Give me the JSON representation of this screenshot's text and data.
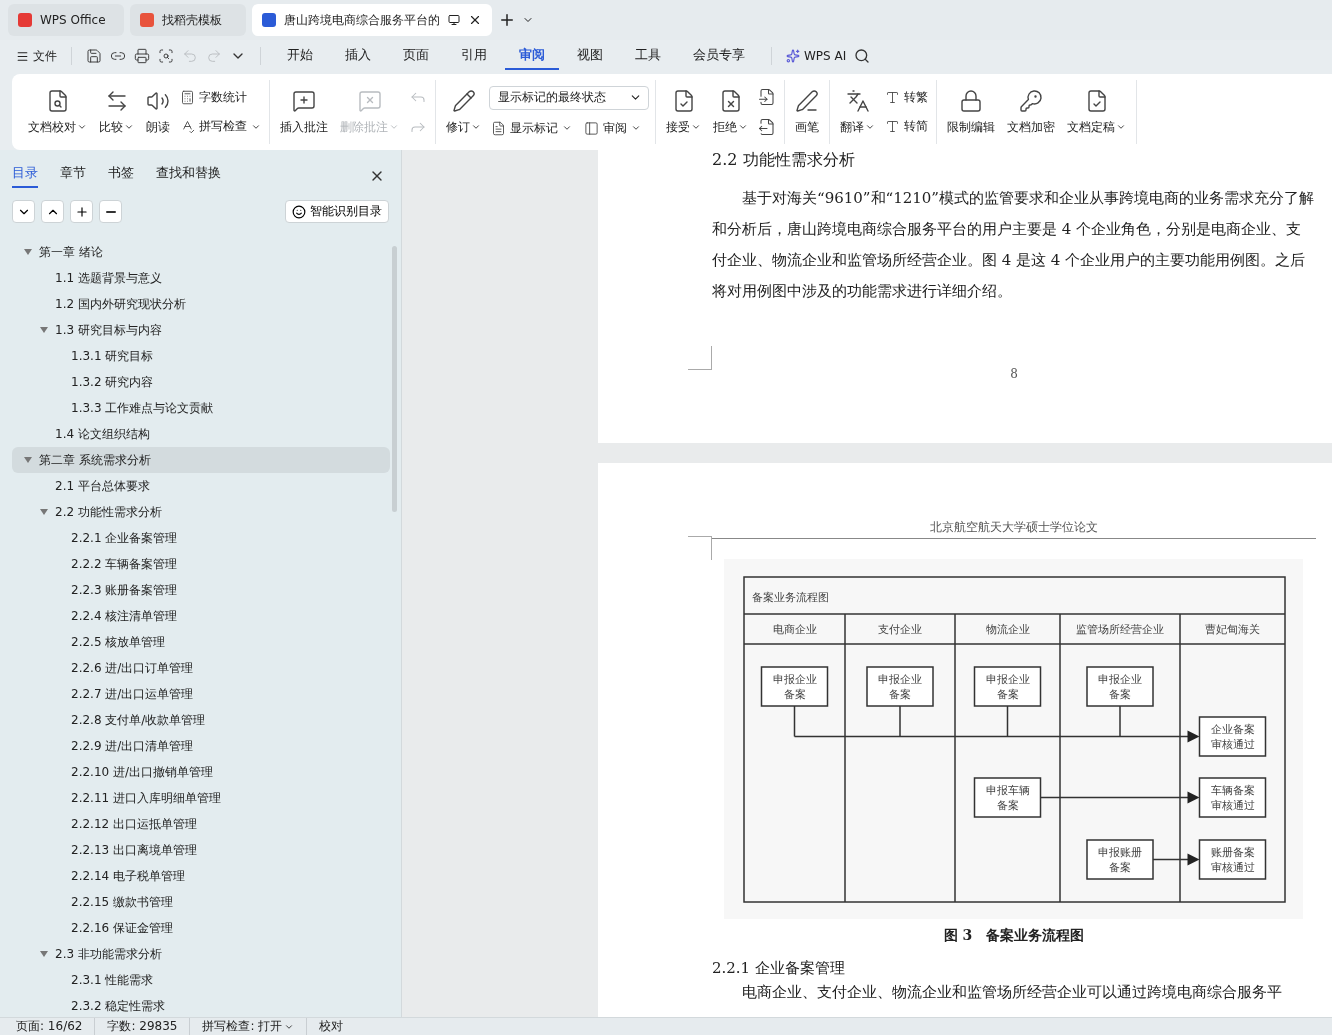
{
  "browser_tabs": [
    {
      "label": "WPS Office",
      "selected": false
    },
    {
      "label": "找稻壳模板",
      "selected": false
    },
    {
      "label": "唐山跨境电商综合服务平台的",
      "selected": true
    }
  ],
  "menu": {
    "file": "文件",
    "tabs": [
      {
        "label": "开始",
        "selected": false
      },
      {
        "label": "插入",
        "selected": false
      },
      {
        "label": "页面",
        "selected": false
      },
      {
        "label": "引用",
        "selected": false
      },
      {
        "label": "审阅",
        "selected": true
      },
      {
        "label": "视图",
        "selected": false
      },
      {
        "label": "工具",
        "selected": false
      },
      {
        "label": "会员专享",
        "selected": false
      }
    ],
    "ai": "WPS AI"
  },
  "ribbon": {
    "groups": [
      {
        "items": [
          {
            "kind": "big",
            "label": "文档校对",
            "dropdown": true
          },
          {
            "kind": "big",
            "label": "比较",
            "dropdown": true
          },
          {
            "kind": "big",
            "label": "朗读",
            "dropdown": false
          },
          {
            "kind": "stack",
            "items": [
              {
                "kind": "small",
                "label": "字数统计",
                "dropdown": false
              },
              {
                "kind": "small",
                "label": "拼写检查",
                "dropdown": true
              }
            ]
          }
        ]
      },
      {
        "items": [
          {
            "kind": "big",
            "label": "插入批注",
            "dropdown": false,
            "disabled": false
          },
          {
            "kind": "big",
            "label": "删除批注",
            "dropdown": true,
            "disabled": true
          },
          {
            "kind": "stack",
            "items": [
              {
                "kind": "icon",
                "disabled": true
              },
              {
                "kind": "icon",
                "disabled": true
              }
            ]
          }
        ]
      },
      {
        "items": [
          {
            "kind": "big",
            "label": "修订",
            "dropdown": true
          },
          {
            "kind": "stack",
            "items": [
              {
                "kind": "select",
                "value": "显示标记的最终状态"
              },
              {
                "kind": "row",
                "items": [
                  {
                    "kind": "small",
                    "label": "显示标记",
                    "dropdown": true
                  },
                  {
                    "kind": "small",
                    "label": "审阅",
                    "dropdown": true
                  }
                ]
              }
            ]
          }
        ]
      },
      {
        "items": [
          {
            "kind": "big",
            "label": "接受",
            "dropdown": true
          },
          {
            "kind": "big",
            "label": "拒绝",
            "dropdown": true
          },
          {
            "kind": "stack",
            "items": [
              {
                "kind": "icon",
                "disabled": false
              },
              {
                "kind": "icon",
                "disabled": false
              }
            ]
          }
        ]
      },
      {
        "items": [
          {
            "kind": "big",
            "label": "画笔",
            "dropdown": false
          }
        ]
      },
      {
        "items": [
          {
            "kind": "big",
            "label": "翻译",
            "dropdown": true
          },
          {
            "kind": "stack",
            "items": [
              {
                "kind": "small",
                "label": "转繁",
                "dropdown": false
              },
              {
                "kind": "small",
                "label": "转简",
                "dropdown": false
              }
            ]
          }
        ]
      },
      {
        "items": [
          {
            "kind": "big",
            "label": "限制编辑",
            "dropdown": false
          },
          {
            "kind": "big",
            "label": "文档加密",
            "dropdown": false
          },
          {
            "kind": "big",
            "label": "文档定稿",
            "dropdown": true
          }
        ]
      }
    ]
  },
  "sidebar": {
    "tabs": [
      {
        "label": "目录",
        "selected": true
      },
      {
        "label": "章节",
        "selected": false
      },
      {
        "label": "书签",
        "selected": false
      },
      {
        "label": "查找和替换",
        "selected": false
      }
    ],
    "smart_button": "智能识别目录",
    "tree": [
      {
        "label": "第一章  绪论",
        "selected": false,
        "expanded": true,
        "children": [
          {
            "label": "1.1  选题背景与意义",
            "selected": false
          },
          {
            "label": "1.2  国内外研究现状分析",
            "selected": false
          },
          {
            "label": "1.3  研究目标与内容",
            "selected": false,
            "expanded": true,
            "children": [
              {
                "label": "1.3.1  研究目标",
                "selected": false
              },
              {
                "label": "1.3.2  研究内容",
                "selected": false
              },
              {
                "label": "1.3.3  工作难点与论文贡献",
                "selected": false
              }
            ]
          },
          {
            "label": "1.4  论文组织结构",
            "selected": false
          }
        ]
      },
      {
        "label": "第二章  系统需求分析",
        "selected": true,
        "expanded": true,
        "children": [
          {
            "label": "2.1  平台总体要求",
            "selected": false
          },
          {
            "label": "2.2  功能性需求分析",
            "selected": false,
            "expanded": true,
            "children": [
              {
                "label": "2.2.1  企业备案管理",
                "selected": false
              },
              {
                "label": "2.2.2  车辆备案管理",
                "selected": false
              },
              {
                "label": "2.2.3  账册备案管理",
                "selected": false
              },
              {
                "label": "2.2.4  核注清单管理",
                "selected": false
              },
              {
                "label": "2.2.5  核放单管理",
                "selected": false
              },
              {
                "label": "2.2.6  进/出口订单管理",
                "selected": false
              },
              {
                "label": "2.2.7  进/出口运单管理",
                "selected": false
              },
              {
                "label": "2.2.8  支付单/收款单管理",
                "selected": false
              },
              {
                "label": "2.2.9  进/出口清单管理",
                "selected": false
              },
              {
                "label": "2.2.10  进/出口撤销单管理",
                "selected": false
              },
              {
                "label": "2.2.11  进口入库明细单管理",
                "selected": false
              },
              {
                "label": "2.2.12  出口运抵单管理",
                "selected": false
              },
              {
                "label": "2.2.13  出口离境单管理",
                "selected": false
              },
              {
                "label": "2.2.14  电子税单管理",
                "selected": false
              },
              {
                "label": "2.2.15  缴款书管理",
                "selected": false
              },
              {
                "label": "2.2.16  保证金管理",
                "selected": false
              }
            ]
          },
          {
            "label": "2.3  非功能需求分析",
            "selected": false,
            "expanded": true,
            "children": [
              {
                "label": "2.3.1  性能需求",
                "selected": false
              },
              {
                "label": "2.3.2  稳定性需求",
                "selected": false
              }
            ]
          }
        ]
      }
    ]
  },
  "document": {
    "page_one": {
      "heading": "2.2  功能性需求分析",
      "paragraph": "基于对海关“9610”和“1210”模式的监管要求和企业从事跨境电商的业务需求充分了解和分析后，唐山跨境电商综合服务平台的用户主要是 4 个企业角色，分别是电商企业、支付企业、物流企业和监管场所经营企业。图 4 是这 4 个企业用户的主要功能用例图。之后将对用例图中涉及的功能需求进行详细介绍。",
      "page_number": "8"
    },
    "page_two": {
      "header": "北京航空航天大学硕士学位论文",
      "figure": {
        "title": "备案业务流程图",
        "lanes": [
          "电商企业",
          "支付企业",
          "物流企业",
          "监管场所经营企业",
          "曹妃甸海关"
        ],
        "nodes": [
          {
            "lines": [
              "申报企业",
              "备案"
            ]
          },
          {
            "lines": [
              "申报企业",
              "备案"
            ]
          },
          {
            "lines": [
              "申报企业",
              "备案"
            ]
          },
          {
            "lines": [
              "申报企业",
              "备案"
            ]
          },
          {
            "lines": [
              "企业备案",
              "审核通过"
            ]
          },
          {
            "lines": [
              "申报车辆",
              "备案"
            ]
          },
          {
            "lines": [
              "车辆备案",
              "审核通过"
            ]
          },
          {
            "lines": [
              "申报账册",
              "备案"
            ]
          },
          {
            "lines": [
              "账册备案",
              "审核通过"
            ]
          }
        ]
      },
      "caption": "图 3　备案业务流程图",
      "subheading": "2.2.1  企业备案管理",
      "paragraph": "电商企业、支付企业、物流企业和监管场所经营企业可以通过跨境电商综合服务平"
    }
  },
  "status_bar": [
    {
      "label": "页面: 16/62",
      "dropdown": false
    },
    {
      "label": "字数: 29835",
      "dropdown": false
    },
    {
      "label": "拼写检查: 打开",
      "dropdown": true
    },
    {
      "label": "校对",
      "dropdown": false
    }
  ]
}
